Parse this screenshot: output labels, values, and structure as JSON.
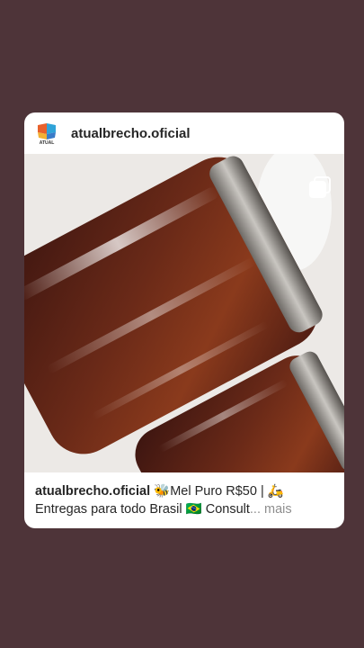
{
  "post": {
    "username": "atualbrecho.oficial",
    "avatar_label": "ATUAL",
    "caption": {
      "username": "atualbrecho.oficial",
      "line1_rest": "🐝Mel Puro R$50 | 🛵",
      "line2": "Entregas para todo Brasil 🇧🇷 Consult",
      "ellipsis": "...",
      "more": "mais"
    }
  },
  "icons": {
    "carousel": "carousel-icon"
  },
  "colors": {
    "background": "#4e3439",
    "card": "#ffffff",
    "text": "#262626",
    "muted": "#8e8e8e"
  }
}
